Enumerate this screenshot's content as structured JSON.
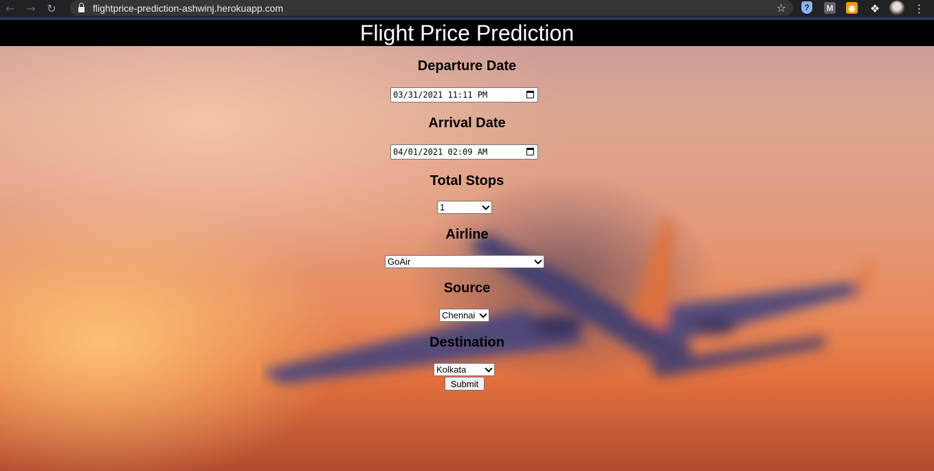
{
  "browser": {
    "url": "flightprice-prediction-ashwinj.herokuapp.com",
    "back_icon": "arrow-left",
    "forward_icon": "arrow-right",
    "reload_icon": "reload",
    "star_icon": "star"
  },
  "header": {
    "title": "Flight Price Prediction"
  },
  "form": {
    "departure": {
      "label": "Departure Date",
      "value": "03/31/2021 11:11 PM"
    },
    "arrival": {
      "label": "Arrival Date",
      "value": "04/01/2021 02:09 AM"
    },
    "stops": {
      "label": "Total Stops",
      "selected": "1"
    },
    "airline": {
      "label": "Airline",
      "selected": "GoAir"
    },
    "source": {
      "label": "Source",
      "selected": "Chennai"
    },
    "destination": {
      "label": "Destination",
      "selected": "Kolkata"
    },
    "submit_label": "Submit"
  }
}
